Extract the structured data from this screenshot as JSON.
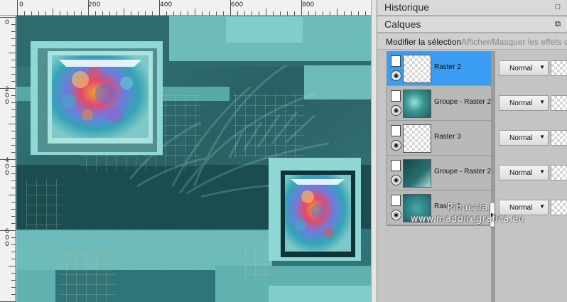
{
  "ruler": {
    "top_labels": [
      "0",
      "200",
      "400",
      "600",
      "800"
    ],
    "left_labels": [
      "0",
      "2\n0\n0",
      "4\n0\n0",
      "6\n0\n0"
    ]
  },
  "panels": {
    "history": {
      "title": "Historique",
      "icon": "maximize-icon"
    },
    "layers": {
      "title": "Calques",
      "icon": "restore-icon"
    }
  },
  "toolbar": {
    "edit_selection": "Modifier la sélection",
    "toggle_effects": "Afficher/Masquer les effets de"
  },
  "layers": [
    {
      "name": "Raster 2",
      "selected": true,
      "blend": "Normal",
      "thumb": "checker-with-frame"
    },
    {
      "name": "Groupe - Raster 2",
      "selected": false,
      "blend": "Normal",
      "thumb": "teal-scatter"
    },
    {
      "name": "Raster 3",
      "selected": false,
      "blend": "Normal",
      "thumb": "checker"
    },
    {
      "name": "Groupe - Raster 2",
      "selected": false,
      "blend": "Normal",
      "thumb": "teal-dark"
    },
    {
      "name": "Raster 1",
      "selected": false,
      "blend": "Normal",
      "thumb": "teal"
    }
  ],
  "watermark": {
    "line1": "Pinuccia",
    "line2": "www.maddiregrafica.eu"
  },
  "colors": {
    "selection": "#3a9cf2",
    "canvas_teal": "#21595c",
    "panel_bg": "#c4c4c4"
  }
}
